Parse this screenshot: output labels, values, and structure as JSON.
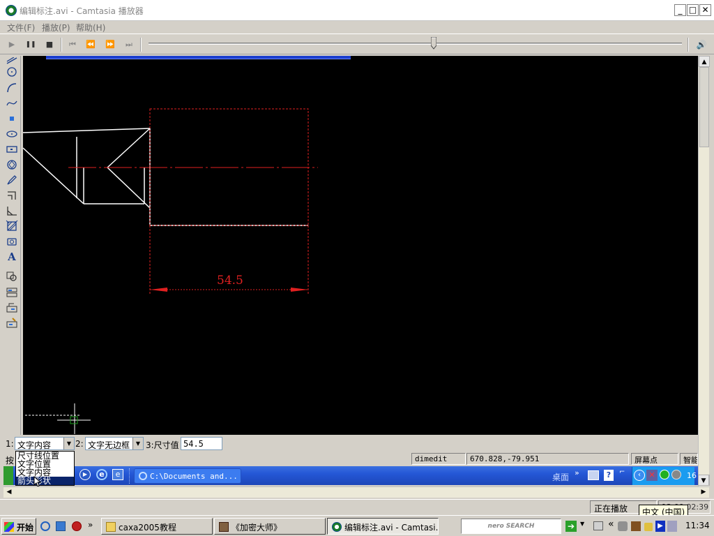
{
  "window": {
    "title": "编辑标注.avi - Camtasia 播放器",
    "controls": {
      "minimize": "_",
      "maximize": "□",
      "close": "✕"
    }
  },
  "menu": {
    "file": "文件(F)",
    "play": "播放(P)",
    "help": "帮助(H)"
  },
  "player_controls": {
    "play": "▶",
    "pause": "❚❚",
    "stop": "■",
    "first": "⏮",
    "rewind": "⏪",
    "forward": "⏩",
    "last": "⏭",
    "volume": "🔊",
    "seek_position": 0.535
  },
  "drawing": {
    "dimension_text": "54.5",
    "colors": {
      "geometry": "#ffffff",
      "dimension": "#e02020",
      "canvas": "#000000"
    }
  },
  "cad_toolbar": {
    "icons": [
      "line-icon",
      "circle-icon",
      "arc-icon",
      "spline-icon",
      "point-icon",
      "ellipse-icon",
      "rectangle-icon",
      "polygon-icon",
      "pencil-icon",
      "polyline-icon",
      "angle-icon",
      "hatch-icon",
      "camera-icon",
      "text-icon",
      "zoom-icon",
      "block-icon",
      "edit-icon",
      "edit2-icon"
    ],
    "text_tool_label": "A"
  },
  "command_bar": {
    "field1_label": "1:",
    "field1_value": "文字内容",
    "field2_label": "2:",
    "field2_value": "文字无边框",
    "field3_label": "3:尺寸值",
    "field3_value": "54.5",
    "dropdown_options": [
      "尺寸线位置",
      "文字位置",
      "文字内容",
      "箭头形状"
    ],
    "selected_index": 3
  },
  "status_row": {
    "prompt": "按",
    "command": "dimedit",
    "coords": "670.828,-79.951",
    "snap": "屏幕点",
    "mode": "智能"
  },
  "inner_taskbar": {
    "path_button": "C:\\Documents and...",
    "desktop_label": "桌面",
    "clock_partial": "16"
  },
  "player_status": {
    "state": "正在播放",
    "time": "12:00:02:39"
  },
  "taskbar": {
    "start": "开始",
    "tasks": [
      "caxa2005教程",
      "《加密大师》",
      "编辑标注.avi - Camtasi..."
    ],
    "search_logo": "nero SEARCH",
    "ime_tooltip": "中文 (中国)",
    "clock": "11:34",
    "chevron": "«"
  }
}
